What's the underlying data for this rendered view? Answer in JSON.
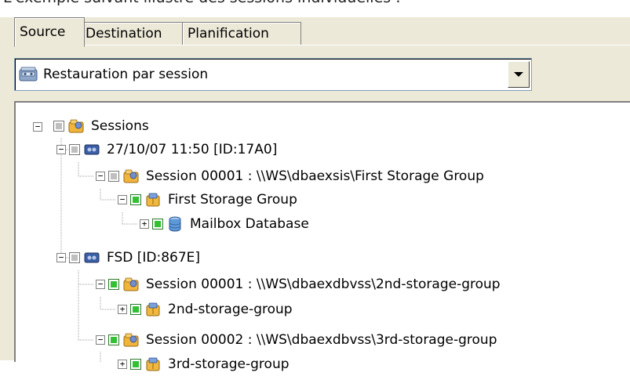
{
  "caption": "L'exemple suivant illustre des sessions individuelles :",
  "tabs": [
    {
      "label": "Source",
      "active": true
    },
    {
      "label": "Destination",
      "active": false
    },
    {
      "label": "Planification",
      "active": false
    }
  ],
  "restore_combo": {
    "selected": "Restauration par session",
    "icon": "tape-drive-icon"
  },
  "tree": {
    "root": {
      "label": "Sessions",
      "icon": "folder-session-icon",
      "expanded": true
    },
    "nodes": [
      {
        "label": "27/10/07 11:50 [ID:17A0]",
        "icon": "tape-icon"
      },
      {
        "label": "Session 00001 : \\\\WS\\dbaexsis\\First Storage Group",
        "icon": "folder-session-icon"
      },
      {
        "label": "First Storage Group",
        "icon": "storage-group-icon"
      },
      {
        "label": "Mailbox Database",
        "icon": "database-icon"
      },
      {
        "label": "FSD [ID:867E]",
        "icon": "tape-icon"
      },
      {
        "label": "Session 00001 : \\\\WS\\dbaexdbvss\\2nd-storage-group",
        "icon": "folder-session-icon"
      },
      {
        "label": "2nd-storage-group",
        "icon": "storage-group-icon"
      },
      {
        "label": "Session 00002 : \\\\WS\\dbaexdbvss\\3rd-storage-group",
        "icon": "folder-session-icon"
      },
      {
        "label": "3rd-storage-group",
        "icon": "storage-group-icon"
      }
    ]
  },
  "colors": {
    "panel": "#ece9d8",
    "check_partial": "#bfbfbf",
    "check_full": "#33c133"
  }
}
